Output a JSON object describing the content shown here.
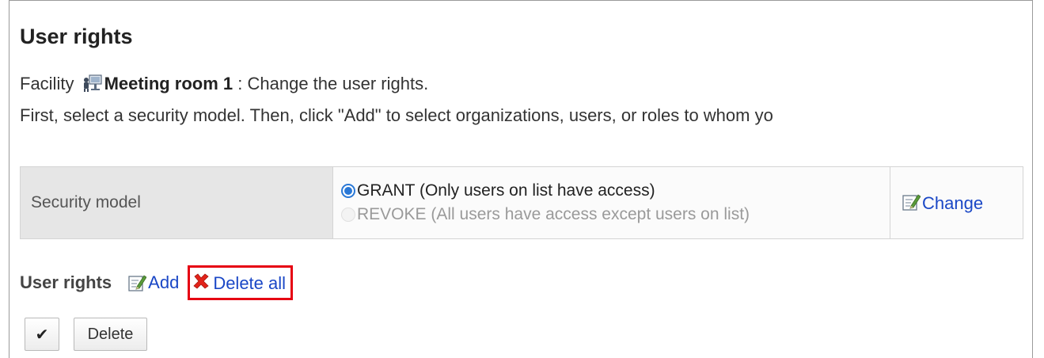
{
  "page": {
    "title": "User rights"
  },
  "description": {
    "facility_prefix": "Facility",
    "facility_name": "Meeting room 1",
    "facility_suffix": " : Change the user rights.",
    "instruction": "First, select a security model. Then, click \"Add\" to select organizations, users, or roles to whom yo"
  },
  "security": {
    "label": "Security model",
    "options": [
      {
        "text": "GRANT (Only users on list have access)",
        "selected": true
      },
      {
        "text": "REVOKE (All users have access except users on list)",
        "selected": false
      }
    ],
    "change_label": "Change"
  },
  "rights": {
    "label": "User rights",
    "add_label": "Add",
    "delete_all_label": "Delete all"
  },
  "buttons": {
    "check_symbol": "✔",
    "delete_label": "Delete"
  },
  "colors": {
    "link": "#1a47c6",
    "highlight": "#e60012",
    "radio_selected": "#2a78d6"
  },
  "icons": {
    "facility": "facility-icon",
    "edit": "edit-icon",
    "delete": "red-x-icon"
  }
}
